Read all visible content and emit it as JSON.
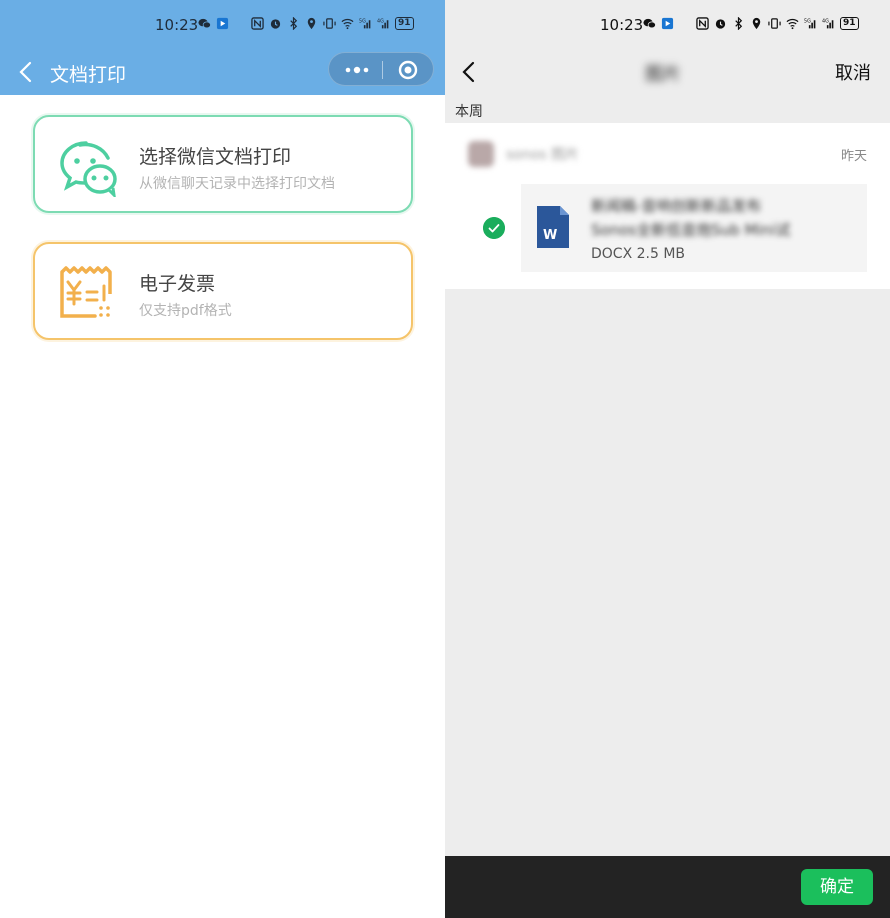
{
  "left": {
    "status": {
      "time": "10:23",
      "battery": "91"
    },
    "header": {
      "title": "文档打印"
    },
    "cards": [
      {
        "title": "选择微信文档打印",
        "subtitle": "从微信聊天记录中选择打印文档",
        "icon": "wechat-chat-icon",
        "color": "#7ddbb3"
      },
      {
        "title": "电子发票",
        "subtitle": "仅支持pdf格式",
        "icon": "invoice-icon",
        "color": "#f5c46a"
      }
    ],
    "header_color": "#6aaee5"
  },
  "right": {
    "status": {
      "time": "10:23",
      "battery": "91"
    },
    "header": {
      "title": "图片",
      "cancel_label": "取消"
    },
    "section_label": "本周",
    "sender": {
      "name": "sonos 图片",
      "date": "昨天"
    },
    "file": {
      "name_line1": "新闻稿-音响创新新品发布",
      "name_line2": "Sonos全新低音炮Sub Mini试",
      "meta": "DOCX 2.5 MB",
      "selected": true,
      "icon": "word-document-icon"
    },
    "confirm_label": "确定",
    "accent_color": "#1bbf5c"
  }
}
